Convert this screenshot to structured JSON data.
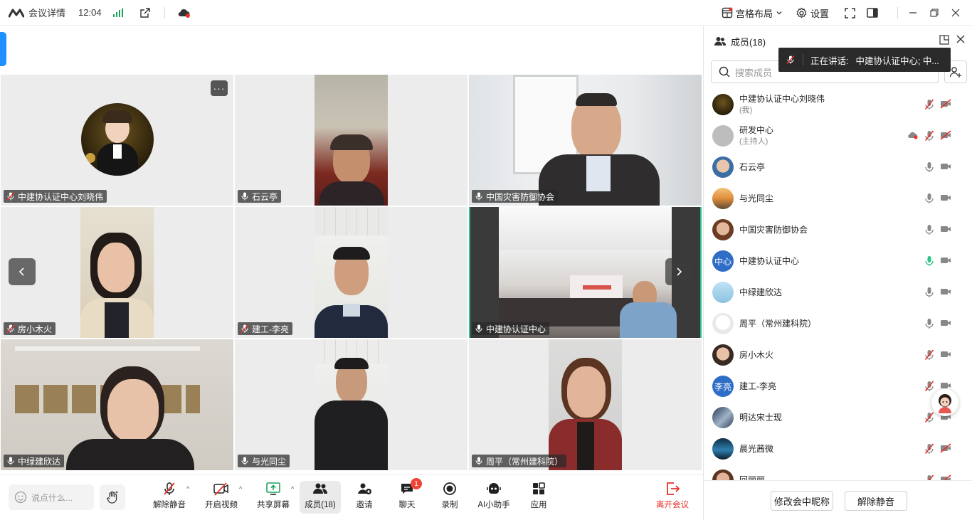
{
  "topbar": {
    "title": "会议详情",
    "time": "12:04",
    "layout_label": "宫格布局",
    "settings_label": "设置"
  },
  "grid": {
    "tiles": [
      {
        "name": "中建协认证中心刘晓伟",
        "mic": "muted"
      },
      {
        "name": "石云亭",
        "mic": "on"
      },
      {
        "name": "中国灾害防御协会",
        "mic": "on"
      },
      {
        "name": "房小木火",
        "mic": "muted"
      },
      {
        "name": "建工-李亮",
        "mic": "muted"
      },
      {
        "name": "中建协认证中心",
        "mic": "on",
        "active": true
      },
      {
        "name": "中绿建欣达",
        "mic": "on"
      },
      {
        "name": "与光同尘",
        "mic": "on"
      },
      {
        "name": "周平（常州建科院）",
        "mic": "on"
      }
    ],
    "more_glyph": "···"
  },
  "toolbar": {
    "chat_placeholder": "说点什么...",
    "unmute": "解除静音",
    "start_video": "开启视频",
    "share_screen": "共享屏幕",
    "members": "成员(18)",
    "invite": "邀请",
    "chat": "聊天",
    "chat_badge": "1",
    "record": "录制",
    "ai_assistant": "AI小助手",
    "apps": "应用",
    "leave": "离开会议"
  },
  "panel": {
    "title": "成员(18)",
    "speaking_label": "正在讲话:",
    "speaking_value": "中建协认证中心; 中...",
    "search_placeholder": "搜索成员",
    "members": [
      {
        "name": "中建协认证中心刘晓伟",
        "sub": "(我)",
        "mic": "muted",
        "cam": "off"
      },
      {
        "name": "研发中心",
        "sub": "(主持人)",
        "mic": "muted",
        "cam": "off",
        "cloud": true
      },
      {
        "name": "石云亭",
        "sub": "",
        "mic": "on",
        "cam": "on"
      },
      {
        "name": "与光同尘",
        "sub": "",
        "mic": "on",
        "cam": "on"
      },
      {
        "name": "中国灾害防御协会",
        "sub": "",
        "mic": "on",
        "cam": "on"
      },
      {
        "name": "中建协认证中心",
        "sub": "",
        "mic": "speaking",
        "cam": "on",
        "avatar_text": "中心"
      },
      {
        "name": "中绿建欣达",
        "sub": "",
        "mic": "on",
        "cam": "on"
      },
      {
        "name": "周平（常州建科院）",
        "sub": "",
        "mic": "on",
        "cam": "on"
      },
      {
        "name": "房小木火",
        "sub": "",
        "mic": "muted",
        "cam": "on"
      },
      {
        "name": "建工-李亮",
        "sub": "",
        "mic": "muted",
        "cam": "on",
        "avatar_text": "李亮"
      },
      {
        "name": "明达宋士现",
        "sub": "",
        "mic": "muted",
        "cam": "on"
      },
      {
        "name": "晨光茜微",
        "sub": "",
        "mic": "muted",
        "cam": "off"
      },
      {
        "name": "回丽丽",
        "sub": "",
        "mic": "muted",
        "cam": "off"
      }
    ],
    "rename_button": "修改会中昵称",
    "unmute_button": "解除静音"
  },
  "colors": {
    "accent_blue": "#1e90ff",
    "active_green": "#2bc58a",
    "muted_red": "#e5332a",
    "leave_red": "#e5332a"
  }
}
